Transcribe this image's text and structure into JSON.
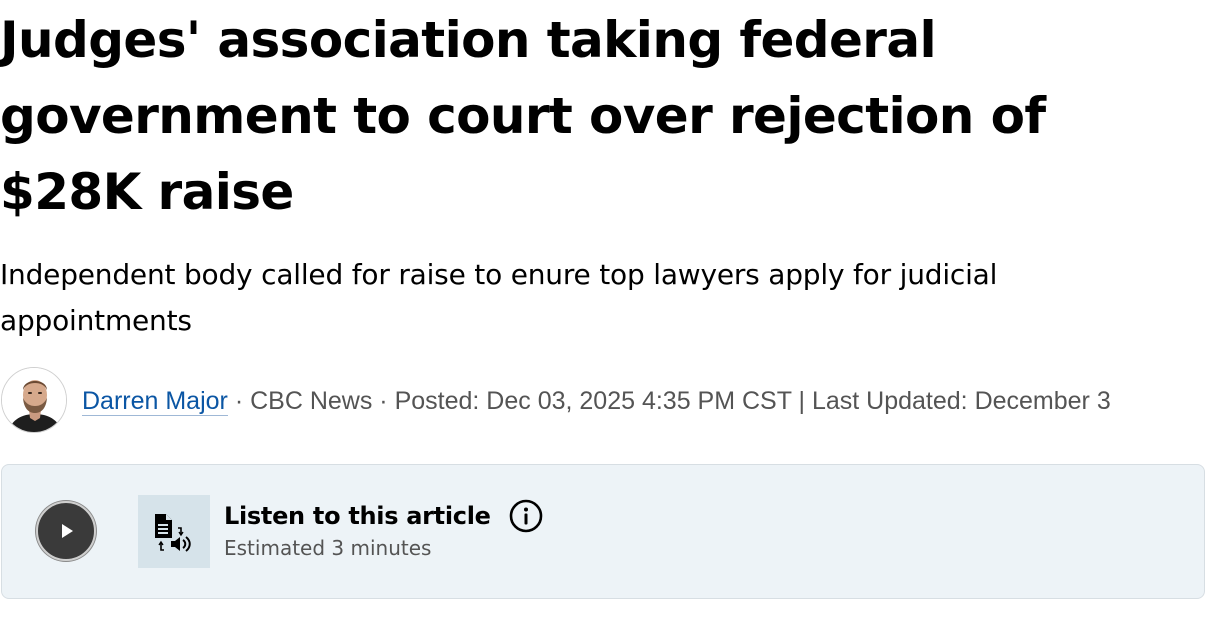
{
  "article": {
    "headline": "Judges' association taking federal government to court over rejection of $28K raise",
    "deck": "Independent body called for raise to enure top lawyers apply for judicial appointments"
  },
  "byline": {
    "author": "Darren Major",
    "separator": " · ",
    "outlet": "CBC News",
    "posted": "Posted: Dec 03, 2025 4:35 PM CST",
    "divider": " | ",
    "updated": "Last Updated: December 3"
  },
  "listen": {
    "title": "Listen to this article",
    "duration": "Estimated 3 minutes"
  },
  "icons": {
    "play": "play-icon",
    "tts": "text-to-speech-icon",
    "info": "info-icon"
  },
  "colors": {
    "author_link": "#0b56a4",
    "meta_text": "#545454",
    "panel_bg": "#edf3f7"
  }
}
